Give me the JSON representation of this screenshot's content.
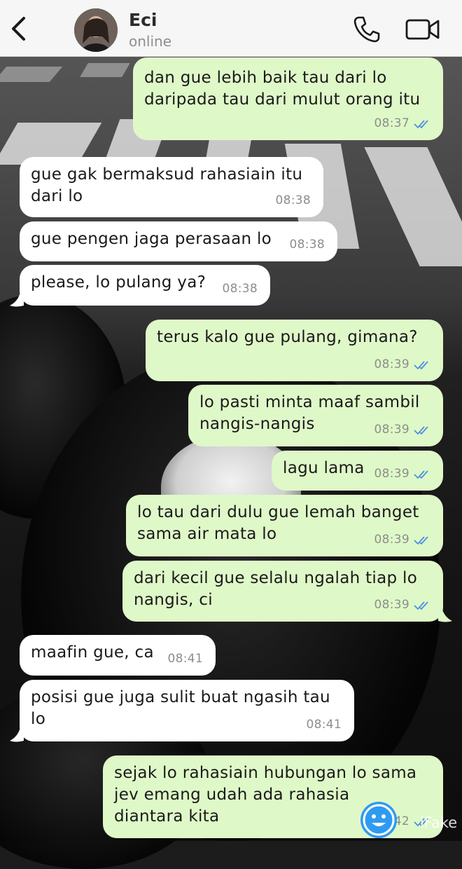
{
  "header": {
    "contact_name": "Eci",
    "contact_status": "online",
    "back_icon": "chevron-left-icon",
    "call_icon": "phone-icon",
    "video_icon": "video-camera-icon"
  },
  "colors": {
    "outgoing_bubble": "#dff8c8",
    "incoming_bubble": "#ffffff",
    "read_ticks": "#4a90e2",
    "header_bg": "#f6f6f6"
  },
  "messages": [
    {
      "direction": "out",
      "text": "dan gue lebih baik tau dari lo\ndaripada tau dari mulut orang itu",
      "time": "08:37",
      "status": "read"
    },
    {
      "direction": "in",
      "text": "gue gak bermaksud rahasiain itu\ndari lo",
      "time": "08:38"
    },
    {
      "direction": "in",
      "text": "gue pengen jaga perasaan lo",
      "time": "08:38"
    },
    {
      "direction": "in",
      "text": "please, lo pulang ya?",
      "time": "08:38"
    },
    {
      "direction": "out",
      "text": "terus kalo gue pulang, gimana?",
      "time": "08:39",
      "status": "read"
    },
    {
      "direction": "out",
      "text": "lo pasti minta maaf sambil\nnangis-nangis",
      "time": "08:39",
      "status": "read"
    },
    {
      "direction": "out",
      "text": "lagu lama",
      "time": "08:39",
      "status": "read"
    },
    {
      "direction": "out",
      "text": "lo tau dari dulu gue lemah banget\nsama air mata lo",
      "time": "08:39",
      "status": "read"
    },
    {
      "direction": "out",
      "text": "dari kecil gue selalu ngalah tiap lo\nnangis, ci",
      "time": "08:39",
      "status": "read"
    },
    {
      "direction": "in",
      "text": "maafin gue, ca",
      "time": "08:41"
    },
    {
      "direction": "in",
      "text": "posisi gue juga sulit buat ngasih tau\nlo",
      "time": "08:41"
    },
    {
      "direction": "out",
      "text": "sejak lo rahasiain hubungan lo sama\njev emang udah ada rahasia\ndiantara kita",
      "time": "08:42",
      "status": "read"
    }
  ],
  "watermark": {
    "text": "iFake",
    "icon": "smiley-face-icon"
  }
}
